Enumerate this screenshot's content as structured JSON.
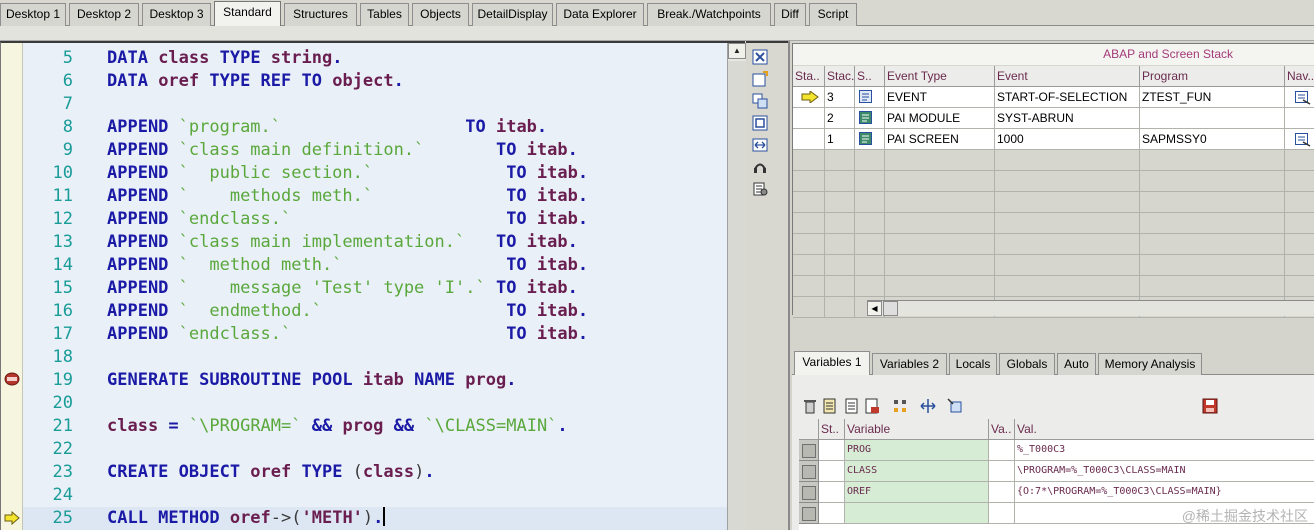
{
  "desktop_tabs": [
    "Desktop 1",
    "Desktop 2",
    "Desktop 3",
    "Standard",
    "Structures",
    "Tables",
    "Objects",
    "DetailDisplay",
    "Data Explorer",
    "Break./Watchpoints",
    "Diff",
    "Script"
  ],
  "active_tab": "Standard",
  "code_lines": [
    {
      "n": "5",
      "parts": [
        [
          "k",
          "DATA "
        ],
        [
          "v",
          "class "
        ],
        [
          "k",
          "TYPE "
        ],
        [
          "v",
          "string"
        ],
        [
          "k",
          "."
        ]
      ]
    },
    {
      "n": "6",
      "parts": [
        [
          "k",
          "DATA "
        ],
        [
          "v",
          "oref "
        ],
        [
          "k",
          "TYPE REF TO "
        ],
        [
          "v",
          "object"
        ],
        [
          "k",
          "."
        ]
      ]
    },
    {
      "n": "7",
      "parts": []
    },
    {
      "n": "8",
      "parts": [
        [
          "k",
          "APPEND "
        ],
        [
          "s",
          "`program.`"
        ],
        [
          "p",
          "                  "
        ],
        [
          "k",
          "TO "
        ],
        [
          "v",
          "itab"
        ],
        [
          "k",
          "."
        ]
      ]
    },
    {
      "n": "9",
      "parts": [
        [
          "k",
          "APPEND "
        ],
        [
          "s",
          "`class main definition.`"
        ],
        [
          "p",
          "       "
        ],
        [
          "k",
          "TO "
        ],
        [
          "v",
          "itab"
        ],
        [
          "k",
          "."
        ]
      ]
    },
    {
      "n": "10",
      "parts": [
        [
          "k",
          "APPEND "
        ],
        [
          "s",
          "`  public section.`"
        ],
        [
          "p",
          "             "
        ],
        [
          "k",
          "TO "
        ],
        [
          "v",
          "itab"
        ],
        [
          "k",
          "."
        ]
      ]
    },
    {
      "n": "11",
      "parts": [
        [
          "k",
          "APPEND "
        ],
        [
          "s",
          "`    methods meth.`"
        ],
        [
          "p",
          "             "
        ],
        [
          "k",
          "TO "
        ],
        [
          "v",
          "itab"
        ],
        [
          "k",
          "."
        ]
      ]
    },
    {
      "n": "12",
      "parts": [
        [
          "k",
          "APPEND "
        ],
        [
          "s",
          "`endclass.`"
        ],
        [
          "p",
          "                     "
        ],
        [
          "k",
          "TO "
        ],
        [
          "v",
          "itab"
        ],
        [
          "k",
          "."
        ]
      ]
    },
    {
      "n": "13",
      "parts": [
        [
          "k",
          "APPEND "
        ],
        [
          "s",
          "`class main implementation.`"
        ],
        [
          "p",
          "   "
        ],
        [
          "k",
          "TO "
        ],
        [
          "v",
          "itab"
        ],
        [
          "k",
          "."
        ]
      ]
    },
    {
      "n": "14",
      "parts": [
        [
          "k",
          "APPEND "
        ],
        [
          "s",
          "`  method meth.`"
        ],
        [
          "p",
          "                "
        ],
        [
          "k",
          "TO "
        ],
        [
          "v",
          "itab"
        ],
        [
          "k",
          "."
        ]
      ]
    },
    {
      "n": "15",
      "parts": [
        [
          "k",
          "APPEND "
        ],
        [
          "s",
          "`    message 'Test' type 'I'.`"
        ],
        [
          "p",
          " "
        ],
        [
          "k",
          "TO "
        ],
        [
          "v",
          "itab"
        ],
        [
          "k",
          "."
        ]
      ]
    },
    {
      "n": "16",
      "parts": [
        [
          "k",
          "APPEND "
        ],
        [
          "s",
          "`  endmethod.`"
        ],
        [
          "p",
          "                  "
        ],
        [
          "k",
          "TO "
        ],
        [
          "v",
          "itab"
        ],
        [
          "k",
          "."
        ]
      ]
    },
    {
      "n": "17",
      "parts": [
        [
          "k",
          "APPEND "
        ],
        [
          "s",
          "`endclass.`"
        ],
        [
          "p",
          "                     "
        ],
        [
          "k",
          "TO "
        ],
        [
          "v",
          "itab"
        ],
        [
          "k",
          "."
        ]
      ]
    },
    {
      "n": "18",
      "parts": []
    },
    {
      "n": "19",
      "parts": [
        [
          "k",
          "GENERATE SUBROUTINE POOL "
        ],
        [
          "v",
          "itab "
        ],
        [
          "k",
          "NAME "
        ],
        [
          "v",
          "prog"
        ],
        [
          "k",
          "."
        ]
      ]
    },
    {
      "n": "20",
      "parts": []
    },
    {
      "n": "21",
      "parts": [
        [
          "v",
          "class "
        ],
        [
          "k",
          "= "
        ],
        [
          "s",
          "`\\PROGRAM=` "
        ],
        [
          "k",
          "&& "
        ],
        [
          "v",
          "prog "
        ],
        [
          "k",
          "&& "
        ],
        [
          "s",
          "`\\CLASS=MAIN`"
        ],
        [
          "k",
          "."
        ]
      ]
    },
    {
      "n": "22",
      "parts": []
    },
    {
      "n": "23",
      "parts": [
        [
          "k",
          "CREATE OBJECT "
        ],
        [
          "v",
          "oref "
        ],
        [
          "k",
          "TYPE "
        ],
        [
          "p",
          "("
        ],
        [
          "v",
          "class"
        ],
        [
          "p",
          ")"
        ],
        [
          "k",
          "."
        ]
      ]
    },
    {
      "n": "24",
      "parts": []
    },
    {
      "n": "25",
      "parts": [
        [
          "k",
          "CALL METHOD "
        ],
        [
          "v",
          "oref"
        ],
        [
          "p",
          "->("
        ],
        [
          "v",
          "'METH'"
        ],
        [
          "p",
          ")"
        ],
        [
          "k",
          "."
        ]
      ]
    }
  ],
  "stack_panel": {
    "title": "ABAP and Screen Stack",
    "headers": [
      "Sta..",
      "Stac..",
      "S..",
      "Event Type",
      "Event",
      "Program",
      "Nav.."
    ],
    "rows": [
      {
        "level": "3",
        "event_type": "EVENT",
        "event": "START-OF-SELECTION",
        "program": "ZTEST_FUN",
        "current": true,
        "nav": true
      },
      {
        "level": "2",
        "event_type": "PAI MODULE",
        "event": "SYST-ABRUN",
        "program": "",
        "current": false,
        "nav": false
      },
      {
        "level": "1",
        "event_type": "PAI SCREEN",
        "event": "1000",
        "program": "SAPMSSY0",
        "current": false,
        "nav": true
      }
    ]
  },
  "variable_tabs": [
    "Variables 1",
    "Variables 2",
    "Locals",
    "Globals",
    "Auto",
    "Memory Analysis"
  ],
  "active_variable_tab": "Variables 1",
  "variables": {
    "headers": [
      "St..",
      "Variable",
      "Va..",
      "Val."
    ],
    "rows": [
      {
        "name": "PROG",
        "value": "%_T000C3"
      },
      {
        "name": "CLASS",
        "value": "\\PROGRAM=%_T000C3\\CLASS=MAIN"
      },
      {
        "name": "OREF",
        "value": "{O:7*\\PROGRAM=%_T000C3\\CLASS=MAIN}"
      },
      {
        "name": "",
        "value": ""
      }
    ]
  },
  "watermark": "@稀土掘金技术社区"
}
